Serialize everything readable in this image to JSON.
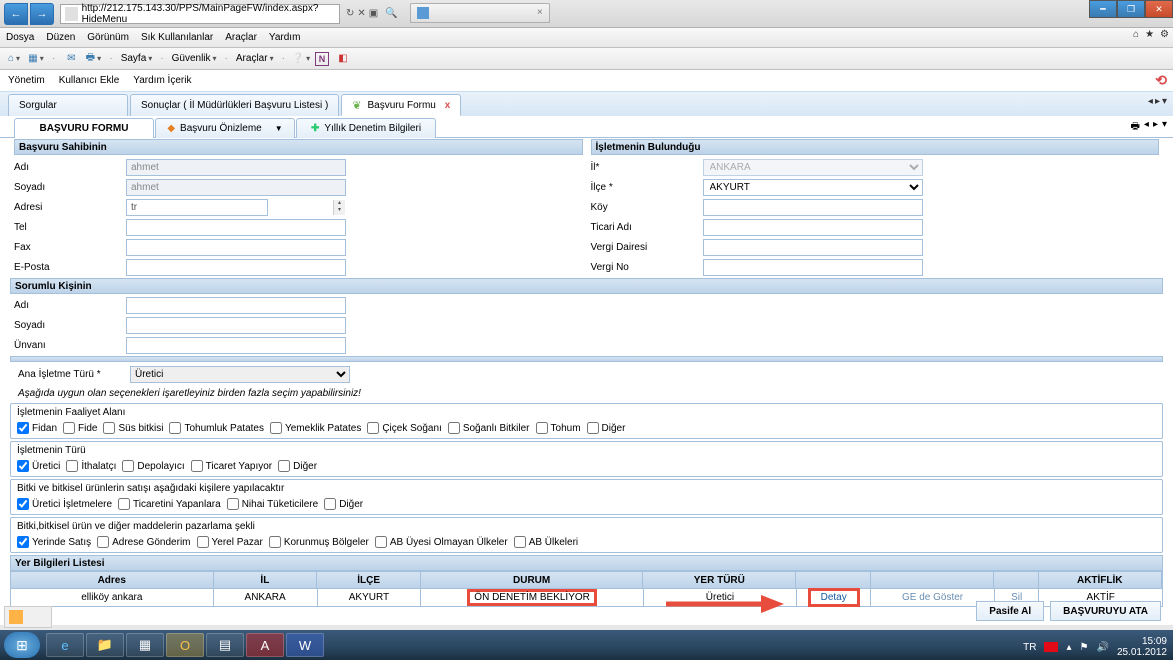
{
  "url": "http://212.175.143.30/PPS/MainPageFW/index.aspx?HideMenu",
  "winmenu": {
    "file": "Dosya",
    "edit": "Düzen",
    "view": "Görünüm",
    "fav": "Sık Kullanılanlar",
    "tools": "Araçlar",
    "help": "Yardım"
  },
  "toolbar2": {
    "home": "",
    "page": "Sayfa",
    "security": "Güvenlik",
    "tools": "Araçlar"
  },
  "topmenu": {
    "yonetim": "Yönetim",
    "kullanici": "Kullanıcı Ekle",
    "yardim": "Yardım İçerik"
  },
  "pagetabs": {
    "sorgular": "Sorgular",
    "sonuclar": "Sonuçlar ( İl Müdürlükleri Başvuru Listesi )",
    "form": "Başvuru Formu"
  },
  "subtabs": {
    "formu": "BAŞVURU FORMU",
    "onizleme": "Başvuru Önizleme",
    "yillik": "Yıllık Denetim Bilgileri"
  },
  "sec": {
    "sahibi": "Başvuru Sahibinin",
    "isletme": "İşletmenin Bulunduğu",
    "sorumlu": "Sorumlu Kişinin",
    "yerlist": "Yer Bilgileri Listesi"
  },
  "lbl": {
    "adi": "Adı",
    "soyadi": "Soyadı",
    "adresi": "Adresi",
    "tel": "Tel",
    "fax": "Fax",
    "eposta": "E-Posta",
    "il": "İl*",
    "ilce": "İlçe *",
    "koy": "Köy",
    "ticari": "Ticari Adı",
    "vdaire": "Vergi Dairesi",
    "vno": "Vergi No",
    "unvan": "Ünvanı",
    "anaturu": "Ana İşletme Türü *"
  },
  "val": {
    "adi": "ahmet",
    "soyadi": "ahmet",
    "adres": "tr",
    "il": "ANKARA",
    "ilce": "AKYURT",
    "anaturu": "Üretici"
  },
  "hint": "Aşağıda uygun olan seçenekleri işaretleyiniz birden fazla seçim yapabilirsiniz!",
  "grp": {
    "faaliyet": {
      "title": "İşletmenin Faaliyet Alanı",
      "opts": [
        "Fidan",
        "Fide",
        "Süs bitkisi",
        "Tohumluk Patates",
        "Yemeklik Patates",
        "Çiçek Soğanı",
        "Soğanlı Bitkiler",
        "Tohum",
        "Diğer"
      ],
      "checked": [
        true,
        false,
        false,
        false,
        false,
        false,
        false,
        false,
        false
      ]
    },
    "turu": {
      "title": "İşletmenin Türü",
      "opts": [
        "Üretici",
        "İthalatçı",
        "Depolayıcı",
        "Ticaret Yapıyor",
        "Diğer"
      ],
      "checked": [
        true,
        false,
        false,
        false,
        false
      ]
    },
    "satis": {
      "title": "Bitki ve bitkisel ürünlerin satışı aşağıdaki kişilere yapılacaktır",
      "opts": [
        "Üretici İşletmelere",
        "Ticaretini Yapanlara",
        "Nihai Tüketicilere",
        "Diğer"
      ],
      "checked": [
        true,
        false,
        false,
        false
      ]
    },
    "pazar": {
      "title": "Bitki,bitkisel ürün ve diğer maddelerin pazarlama şekli",
      "opts": [
        "Yerinde Satış",
        "Adrese Gönderim",
        "Yerel Pazar",
        "Korunmuş Bölgeler",
        "AB Üyesi Olmayan Ülkeler",
        "AB Ülkeleri"
      ],
      "checked": [
        true,
        false,
        false,
        false,
        false,
        false
      ]
    }
  },
  "table": {
    "headers": {
      "adres": "Adres",
      "il": "İL",
      "ilce": "İLÇE",
      "durum": "DURUM",
      "yer": "YER TÜRÜ",
      "aktif": "AKTİFLİK"
    },
    "row": {
      "adres": "elliköy ankara",
      "il": "ANKARA",
      "ilce": "AKYURT",
      "durum": "ÖN DENETİM BEKLİYOR",
      "yer": "Üretici",
      "detay": "Detay",
      "ge": "GE de Göster",
      "sil": "Sil",
      "aktif": "AKTİF"
    }
  },
  "bottom": {
    "pasife": "Pasife Al",
    "ata": "BAŞVURUYU ATA"
  },
  "sys": {
    "lang": "TR",
    "time": "15:09",
    "date": "25.01.2012"
  }
}
